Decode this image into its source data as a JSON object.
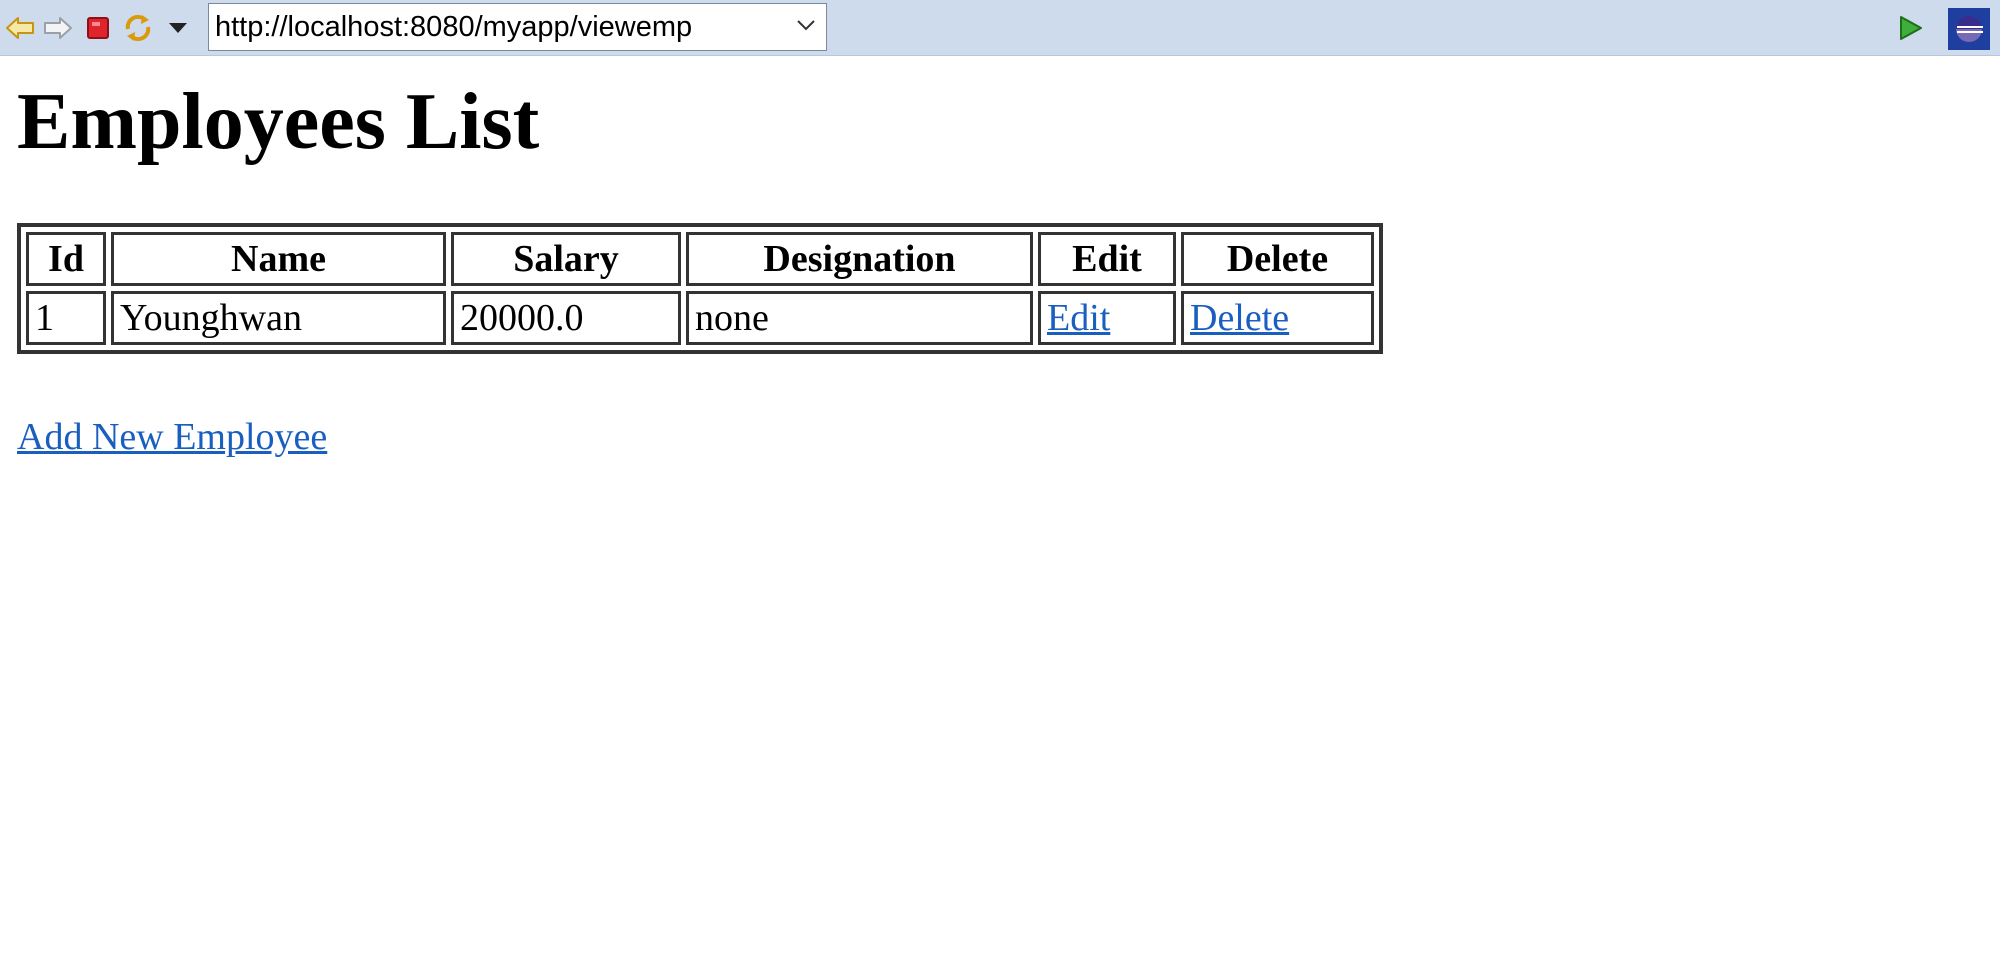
{
  "browser": {
    "url": "http://localhost:8080/myapp/viewemp",
    "icons": {
      "back": "back-arrow-icon",
      "forward": "forward-arrow-icon",
      "stop": "stop-icon",
      "refresh": "refresh-icon",
      "menu": "dropdown-triangle-icon",
      "go": "go-play-icon",
      "app": "eclipse-icon"
    }
  },
  "page": {
    "title": "Employees List",
    "table": {
      "headers": [
        "Id",
        "Name",
        "Salary",
        "Designation",
        "Edit",
        "Delete"
      ],
      "rows": [
        {
          "id": "1",
          "name": "Younghwan",
          "salary": "20000.0",
          "designation": "none",
          "edit_label": "Edit",
          "delete_label": "Delete"
        }
      ]
    },
    "add_link": "Add New Employee"
  },
  "colors": {
    "toolbar_bg": "#cddbec",
    "link": "#1a5fc0",
    "table_border": "#333333"
  }
}
